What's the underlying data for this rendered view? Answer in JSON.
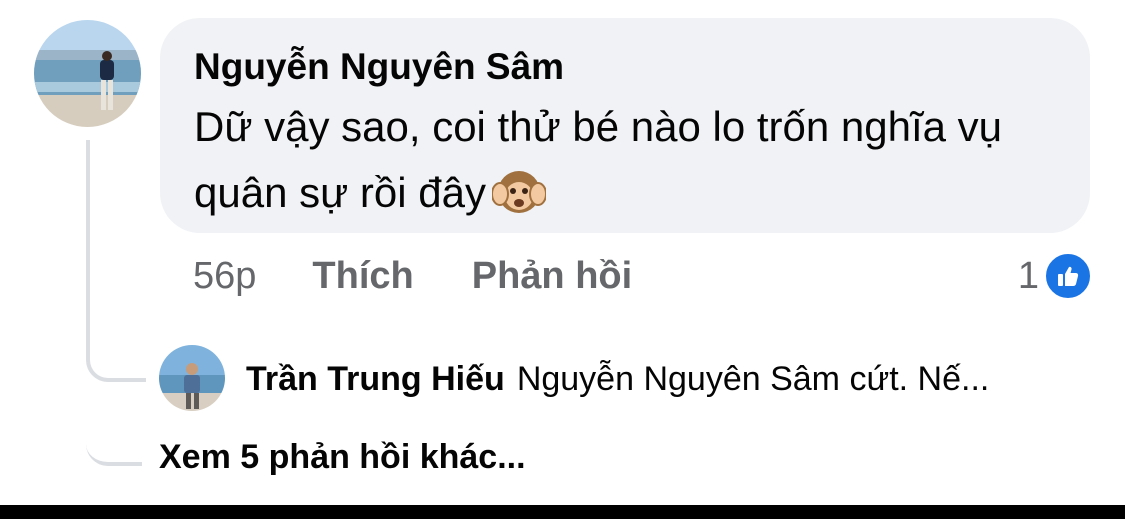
{
  "comment": {
    "author": "Nguyễn Nguyên Sâm",
    "text": "Dữ vậy sao, coi thử bé nào lo trốn nghĩa vụ quân sự rồi đây",
    "emoji": "hear-no-evil-monkey-icon",
    "time": "56p",
    "like_label": "Thích",
    "reply_label": "Phản hồi",
    "reaction_count": "1",
    "reaction_icon": "like-icon"
  },
  "reply": {
    "author": "Trần Trung Hiếu",
    "text": "Nguyễn Nguyên Sâm cứt. Nế..."
  },
  "more_replies_label": "Xem 5 phản hồi khác...",
  "colors": {
    "bubble": "#f0f2f5",
    "secondary_text": "#65676b",
    "like_blue": "#1b74e4",
    "thread_line": "#dadde1"
  }
}
